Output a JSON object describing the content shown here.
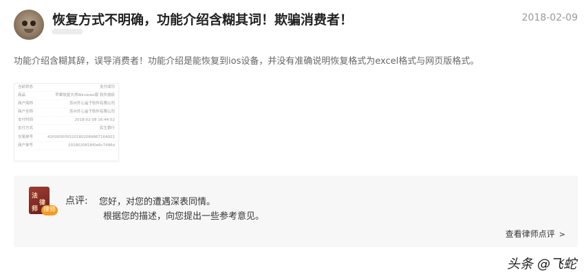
{
  "post": {
    "title": "恢复方式不明确，功能介绍含糊其词！欺骗消费者！",
    "date": "2018-02-09",
    "description": "功能介绍含糊其辞，误导消费者！功能介绍是能恢复到ios设备，并没有准确说明恢复格式为excel格式与网页版格式。"
  },
  "receipt": {
    "rows": [
      {
        "key": "当前状态",
        "value": "支付成功"
      },
      {
        "key": "商品",
        "value": "苹果恢复大师Windows版 软件授权"
      },
      {
        "key": "商户简称",
        "value": "苏州开心盒子软件有限公司"
      },
      {
        "key": "商户全称",
        "value": "苏州开心盒子软件有限公司"
      },
      {
        "key": "支付时间",
        "value": "2018-02-08 16:44:52"
      },
      {
        "key": "支付方式",
        "value": "民生银行"
      },
      {
        "key": "交易单号",
        "value": "4200000055201802089867164922"
      },
      {
        "key": "商户单号",
        "value": "2018020816f0e6c7496d"
      }
    ]
  },
  "reply": {
    "lawyer_badge": "律师",
    "label": "点评:",
    "line1": "您好，对您的遭遇深表同情。",
    "line2": "根据您的描述，向您提出一些参考意见。",
    "view_link": "查看律师点评",
    "view_chevron": ">"
  },
  "watermark": "头条 @飞蛇"
}
